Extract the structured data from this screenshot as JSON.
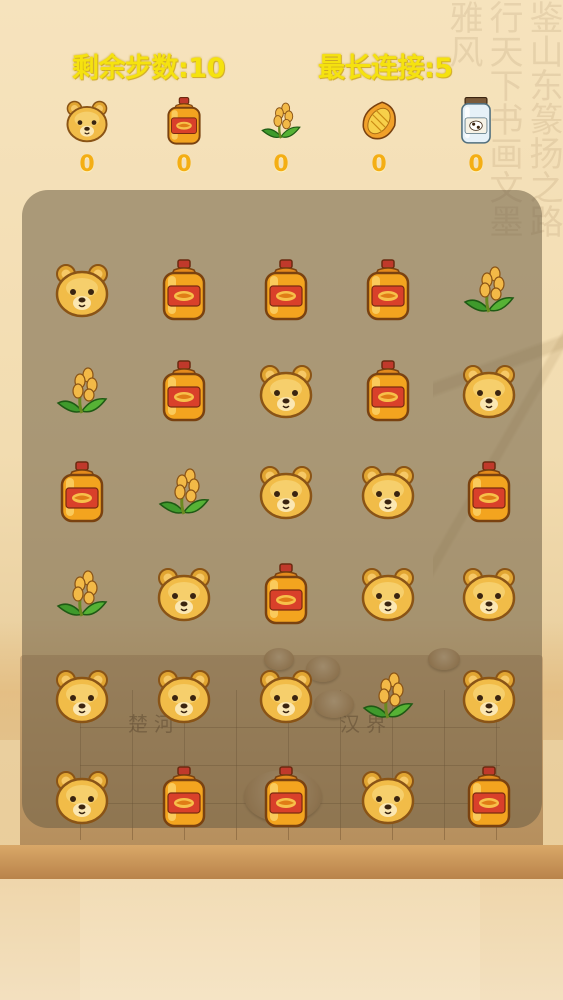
{
  "hud": {
    "moves_left": "剩余步数:10",
    "longest_chain": "最长连接:5"
  },
  "goals": [
    {
      "icon": "bear-icon",
      "count": "0"
    },
    {
      "icon": "oil-bottle-icon",
      "count": "0"
    },
    {
      "icon": "rice-icon",
      "count": "0"
    },
    {
      "icon": "corn-icon",
      "count": "0"
    },
    {
      "icon": "milk-jar-icon",
      "count": "0"
    }
  ],
  "board": {
    "rows": [
      [
        "bear",
        "oil",
        "oil",
        "oil",
        "rice"
      ],
      [
        "rice",
        "oil",
        "bear",
        "oil",
        "bear"
      ],
      [
        "oil",
        "rice",
        "bear",
        "bear",
        "oil"
      ],
      [
        "rice",
        "bear",
        "oil",
        "bear",
        "bear"
      ],
      [
        "bear",
        "bear",
        "bear",
        "rice",
        "bear"
      ],
      [
        "bear",
        "oil",
        "oil",
        "bear",
        "oil"
      ]
    ]
  },
  "background": {
    "river_left": "楚河",
    "river_right": "汉界",
    "calligraphy": "鉴山东篆扬之路行天下书画文墨雅风"
  },
  "colors": {
    "hud_text": "#f5e20f",
    "goal_count": "#f4ae14",
    "board_overlay": "#6e5f46"
  }
}
